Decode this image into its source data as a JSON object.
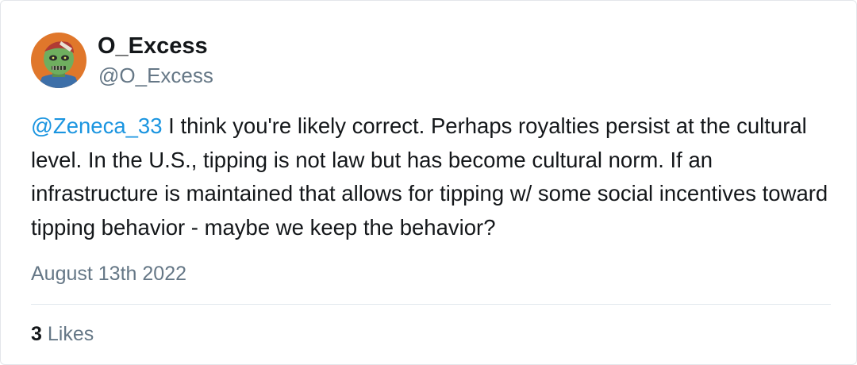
{
  "author": {
    "display_name": "O_Excess",
    "handle": "@O_Excess",
    "avatar_icon": "zombie-avatar"
  },
  "tweet": {
    "mention": "@Zeneca_33",
    "text": " I think you're likely correct. Perhaps royalties persist at the cultural level. In the U.S., tipping is not law but has become cultural norm. If an infrastructure is maintained that allows for tipping w/ some social incentives toward tipping behavior - maybe we keep the behavior?",
    "date": "August 13th 2022"
  },
  "engagement": {
    "likes_count": "3",
    "likes_label": "Likes"
  },
  "colors": {
    "mention": "#1b95e0",
    "muted": "#657786",
    "text": "#14171a",
    "avatar_bg": "#e0772b"
  }
}
